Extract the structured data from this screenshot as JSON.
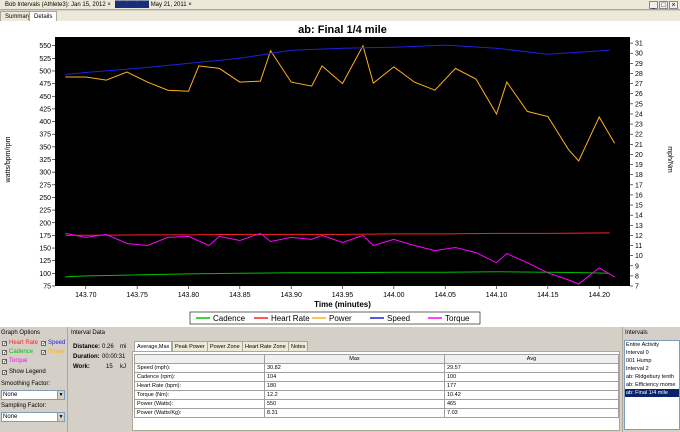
{
  "window": {
    "doc_tab_1": "Bob Intervals (Athlete3): Jan 15, 2012",
    "doc_tab_2": "May 21, 2011",
    "doc_tab_2_redacted": "████████",
    "minimize": "_",
    "maximize": "□",
    "close": "×"
  },
  "tabs": [
    "Summary",
    "Details"
  ],
  "active_tab": "Details",
  "chart_data": {
    "type": "line",
    "title": "ab: Final 1/4 mile",
    "xlabel": "Time (minutes)",
    "ylabel_left": "watts/bpm/rpm",
    "ylabel_right": "mph/Nm",
    "xlim": [
      143.67,
      144.23
    ],
    "ylim_left": [
      75,
      575
    ],
    "ylim_right": [
      7,
      32
    ],
    "x_ticks": [
      "143.70",
      "143.75",
      "143.80",
      "143.85",
      "143.90",
      "143.95",
      "144.00",
      "144.05",
      "144.10",
      "144.15",
      "144.20"
    ],
    "y_ticks_left": [
      "75",
      "100",
      "125",
      "150",
      "175",
      "200",
      "225",
      "250",
      "275",
      "300",
      "325",
      "350",
      "375",
      "400",
      "425",
      "450",
      "475",
      "500",
      "525",
      "550"
    ],
    "y_ticks_right": [
      "7",
      "8",
      "9",
      "10",
      "11",
      "12",
      "13",
      "14",
      "15",
      "16",
      "17",
      "18",
      "19",
      "20",
      "21",
      "22",
      "23",
      "24",
      "25",
      "26",
      "27",
      "28",
      "29",
      "30",
      "31",
      "32"
    ],
    "background": "#000000",
    "grid": false,
    "legend_position": "bottom",
    "series": [
      {
        "name": "Cadence",
        "axis": "left",
        "color": "#00c000",
        "x": [
          143.68,
          143.7,
          143.75,
          143.8,
          143.85,
          143.9,
          143.95,
          144.0,
          144.05,
          144.1,
          144.15,
          144.19,
          144.21
        ],
        "values": [
          93,
          95,
          97,
          99,
          100,
          101,
          101,
          102,
          102,
          103,
          102,
          101,
          100
        ]
      },
      {
        "name": "Heart Rate",
        "axis": "left",
        "color": "#ff2020",
        "x": [
          143.68,
          143.75,
          143.8,
          143.85,
          143.9,
          143.95,
          144.0,
          144.05,
          144.1,
          144.15,
          144.21
        ],
        "values": [
          175,
          176,
          176,
          177,
          177,
          177,
          178,
          178,
          179,
          179,
          180
        ]
      },
      {
        "name": "Power",
        "axis": "left",
        "color": "#ffb020",
        "x": [
          143.68,
          143.7,
          143.72,
          143.74,
          143.76,
          143.78,
          143.8,
          143.81,
          143.83,
          143.85,
          143.87,
          143.88,
          143.9,
          143.92,
          143.93,
          143.95,
          143.97,
          143.98,
          144.0,
          144.02,
          144.04,
          144.06,
          144.08,
          144.1,
          144.11,
          144.13,
          144.15,
          144.17,
          144.18,
          144.2,
          144.215
        ],
        "values": [
          488,
          488,
          482,
          498,
          478,
          462,
          460,
          510,
          505,
          478,
          480,
          540,
          478,
          470,
          510,
          475,
          550,
          476,
          508,
          478,
          462,
          505,
          484,
          415,
          478,
          420,
          410,
          345,
          322,
          409,
          357
        ]
      },
      {
        "name": "Speed",
        "axis": "right",
        "color": "#2020e0",
        "x": [
          143.68,
          143.7,
          143.75,
          143.8,
          143.85,
          143.9,
          143.95,
          144.0,
          144.05,
          144.1,
          144.15,
          144.21
        ],
        "values": [
          27.9,
          28.1,
          28.5,
          29.0,
          29.5,
          30.3,
          30.5,
          30.6,
          30.8,
          30.5,
          29.9,
          30.3
        ]
      },
      {
        "name": "Torque",
        "axis": "right",
        "color": "#ff00ff",
        "x": [
          143.68,
          143.7,
          143.72,
          143.74,
          143.76,
          143.78,
          143.8,
          143.82,
          143.83,
          143.85,
          143.87,
          143.88,
          143.9,
          143.92,
          143.93,
          143.95,
          143.97,
          143.98,
          144.0,
          144.02,
          144.04,
          144.06,
          144.08,
          144.1,
          144.11,
          144.13,
          144.15,
          144.17,
          144.18,
          144.2,
          144.215
        ],
        "values": [
          12.2,
          11.8,
          12.1,
          11.2,
          11.0,
          11.8,
          11.9,
          11.0,
          11.9,
          11.5,
          12.2,
          11.4,
          11.8,
          11.6,
          12.0,
          11.3,
          12.0,
          11.0,
          11.6,
          11.0,
          10.5,
          10.8,
          10.3,
          9.3,
          10.2,
          9.3,
          8.3,
          7.6,
          7.2,
          8.8,
          7.9
        ]
      }
    ]
  },
  "graph_options": {
    "title": "Graph Options",
    "items": [
      {
        "label": "Heart Rate",
        "checked": true,
        "color": "#ff2020"
      },
      {
        "label": "Speed",
        "checked": true,
        "color": "#2020e0"
      },
      {
        "label": "Cadence",
        "checked": true,
        "color": "#00c000"
      },
      {
        "label": "Power",
        "checked": true,
        "color": "#ffb020"
      },
      {
        "label": "Torque",
        "checked": true,
        "color": "#ff00ff"
      }
    ],
    "show_legend": "Show Legend",
    "smoothing_label": "Smoothing Factor:",
    "smoothing_value": "None",
    "sampling_label": "Sampling Factor:",
    "sampling_value": "None"
  },
  "interval_data": {
    "title": "Interval Data",
    "distance_label": "Distance:",
    "distance_value": "0.26",
    "distance_unit": "mi",
    "duration_label": "Duration:",
    "duration_value": "00:00:31",
    "work_label": "Work:",
    "work_value": "15",
    "work_unit": "kJ",
    "subtabs": [
      "Average,Max",
      "Peak Power",
      "Power Zone",
      "Heart Rate Zone",
      "Notes"
    ],
    "active_subtab": "Average,Max",
    "table_headers": [
      "",
      "Max",
      "Avg"
    ],
    "rows": [
      [
        "Speed (mph):",
        "30.82",
        "29.57"
      ],
      [
        "Cadence (rpm):",
        "104",
        "100"
      ],
      [
        "Heart Rate (bpm):",
        "180",
        "177"
      ],
      [
        "Torque (Nm):",
        "12.2",
        "10.42"
      ],
      [
        "Power (Watts):",
        "550",
        "465"
      ],
      [
        "Power (Watts/Kg):",
        "8.31",
        "7.03"
      ]
    ]
  },
  "intervals": {
    "title": "Intervals",
    "items": [
      "Entire Activity",
      "Interval 0",
      "001 Hump",
      "Interval 2",
      "ab: Ridgebury tenth",
      "ab: Efficiency mome",
      "ab: Final 1/4 mile"
    ],
    "selected": "ab: Final 1/4 mile"
  }
}
